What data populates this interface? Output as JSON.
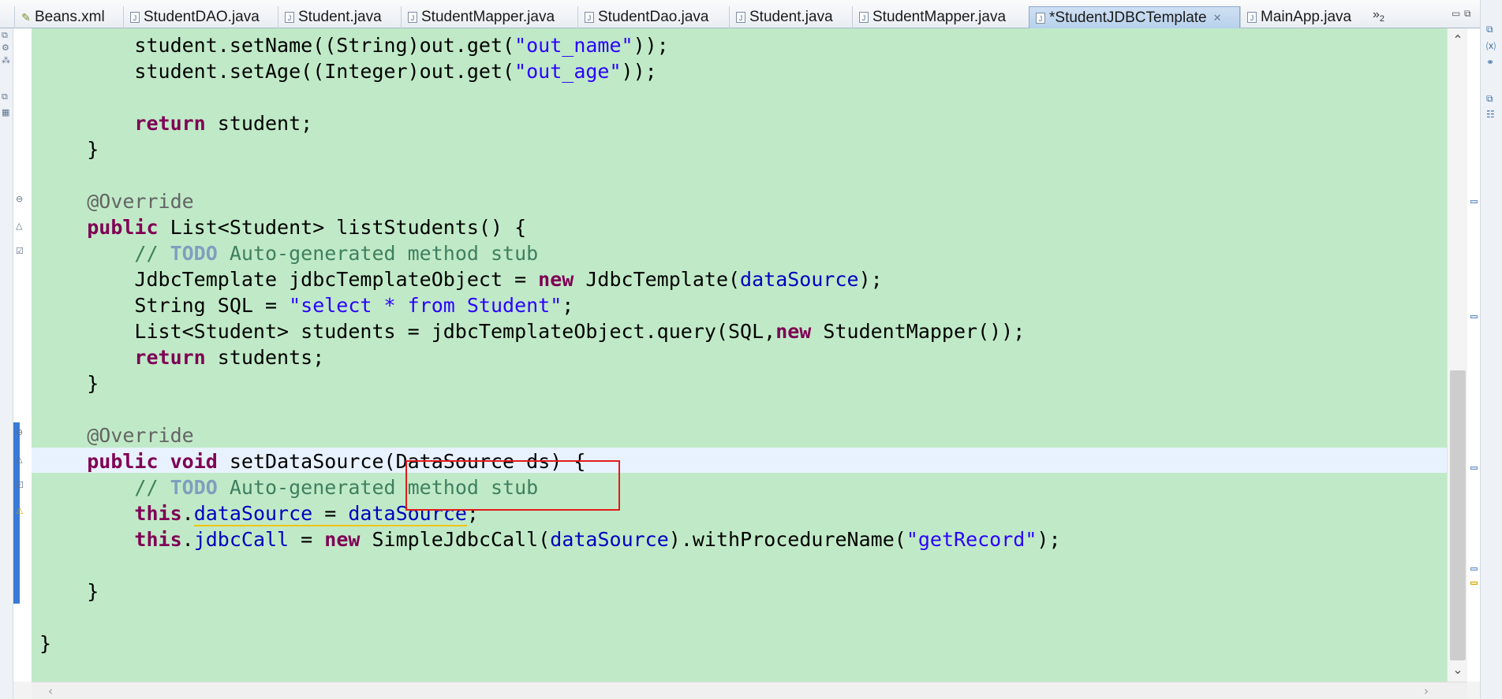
{
  "tabs": [
    {
      "label": "Beans.xml",
      "icon": "xml-file-icon",
      "active": false
    },
    {
      "label": "StudentDAO.java",
      "icon": "java-file-icon",
      "active": false
    },
    {
      "label": "Student.java",
      "icon": "java-file-icon",
      "active": false
    },
    {
      "label": "StudentMapper.java",
      "icon": "java-file-icon",
      "active": false
    },
    {
      "label": "StudentDao.java",
      "icon": "java-file-icon",
      "active": false
    },
    {
      "label": "Student.java",
      "icon": "java-file-icon",
      "active": false
    },
    {
      "label": "StudentMapper.java",
      "icon": "java-file-icon",
      "active": false
    },
    {
      "label": "*StudentJDBCTemplate",
      "icon": "java-file-icon",
      "active": true,
      "close": "✕"
    },
    {
      "label": "MainApp.java",
      "icon": "java-file-icon",
      "active": false
    }
  ],
  "tab_overflow": {
    "chevron": "»",
    "count": "2"
  },
  "editor": {
    "background": "#c0eac7",
    "current_line_background": "#e8f2fe",
    "highlight_box_color": "#e21b1b",
    "lines": {
      "l1": {
        "indent": "        ",
        "a": "student.setName((String)out.get(",
        "s": "\"out_name\"",
        "b": "));"
      },
      "l2": {
        "indent": "        ",
        "a": "student.setAge((Integer)out.get(",
        "s": "\"out_age\"",
        "b": "));"
      },
      "l3": {
        "indent": "        ",
        "kw": "return",
        "rest": " student;"
      },
      "l4": {
        "text": "    }"
      },
      "l5": {
        "indent": "    ",
        "ann": "@Override"
      },
      "l6": {
        "indent": "    ",
        "kw": "public",
        "rest": " List<Student> listStudents() {"
      },
      "l7": {
        "indent": "        ",
        "c1": "// ",
        "todo": "TODO",
        "c2": " Auto-generated method stub"
      },
      "l8": {
        "indent": "        ",
        "a": "JdbcTemplate jdbcTemplateObject = ",
        "kw": "new",
        "b": " JdbcTemplate(",
        "fld": "dataSource",
        "c": ");"
      },
      "l9": {
        "indent": "        ",
        "a": "String SQL = ",
        "s": "\"select * from Student\"",
        "b": ";"
      },
      "l10": {
        "indent": "        ",
        "a": "List<Student> students = jdbcTemplateObject.query(SQL,",
        "kw": "new",
        "b": " StudentMapper());"
      },
      "l11": {
        "indent": "        ",
        "kw": "return",
        "rest": " students;"
      },
      "l12": {
        "text": "    }"
      },
      "l13": {
        "indent": "    ",
        "ann": "@Override"
      },
      "l14": {
        "indent": "    ",
        "kw1": "public",
        "sp": " ",
        "kw2": "void",
        "rest": " setDataSource(DataSource ds) {"
      },
      "l15": {
        "indent": "        ",
        "c1": "// ",
        "todo": "TODO",
        "c2": " Auto-generated method stub"
      },
      "l16": {
        "indent": "        ",
        "kw": "this",
        "dot": ".",
        "fld1": "dataSource",
        "eq": " = ",
        "fld2": "dataSource",
        "end": ";"
      },
      "l17": {
        "indent": "        ",
        "kw": "this",
        "dot": ".",
        "fld1": "jdbcCall",
        "eq": " = ",
        "kw2": "new",
        "a": " SimpleJdbcCall(",
        "fld2": "dataSource",
        "b": ").withProcedureName(",
        "s": "\"getRecord\"",
        "c": ");"
      },
      "l18": {
        "text": "    }"
      },
      "l19": {
        "text": "}"
      }
    }
  },
  "scrollbars": {
    "up": "⌃",
    "down": "⌄",
    "left": "‹",
    "right": "›"
  }
}
